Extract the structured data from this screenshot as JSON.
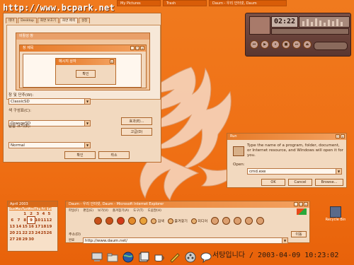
{
  "watermark": "http://www.bcpark.net",
  "taskbar_top": [
    {
      "label": "My Pictures"
    },
    {
      "label": "Trash"
    },
    {
      "label": "Daum - 우리 인터넷, Daum"
    }
  ],
  "display_props": {
    "tabs": [
      "테마",
      "Desktop",
      "화면 보호기",
      "화면 배색",
      "설정"
    ],
    "active_tab": 3,
    "preview_msg_title": "메시지 상자",
    "preview_normal_label": "창 제목",
    "preview_ok": "확인",
    "preview_inactive": "비활성 창",
    "window_buttons_label": "창 및 단추(W):",
    "window_buttons_value": "ClassicSD",
    "color_scheme_label": "색 구성표(C):",
    "color_scheme_value": "OrangeSD",
    "font_size_label": "글꼴 크기(E):",
    "font_size_value": "Normal",
    "effects_button": "효과(E)...",
    "advanced_button": "고급(D)",
    "ok_button": "확인",
    "cancel_button": "취소"
  },
  "media_player": {
    "time": "02:22",
    "controls": [
      "prev",
      "play",
      "pause",
      "stop",
      "next",
      "eject"
    ]
  },
  "run_dialog": {
    "title": "Run",
    "message": "Type the name of a program, folder, document, or Internet resource, and Windows will open it for you.",
    "open_label": "Open:",
    "open_value": "cmd.exe",
    "ok": "OK",
    "cancel": "Cancel",
    "browse": "Browse..."
  },
  "calendar": {
    "month": "April 2003",
    "weekdays": [
      "Sun",
      "Mon",
      "Tue",
      "Wed",
      "Thu",
      "Fri",
      "Sat"
    ],
    "weeks": [
      [
        "",
        "",
        "1",
        "2",
        "3",
        "4",
        "5"
      ],
      [
        "6",
        "7",
        "8",
        "9",
        "10",
        "11",
        "12"
      ],
      [
        "13",
        "14",
        "15",
        "16",
        "17",
        "18",
        "19"
      ],
      [
        "20",
        "21",
        "22",
        "23",
        "24",
        "25",
        "26"
      ],
      [
        "27",
        "28",
        "29",
        "30",
        "",
        "",
        ""
      ]
    ],
    "today": "9"
  },
  "browser": {
    "title": "Daum - 우리 인터넷, Daum - Microsoft Internet Explorer",
    "menu": [
      "파일(F)",
      "편집(E)",
      "보기(V)",
      "즐겨찾기(A)",
      "도구(T)",
      "도움말(H)"
    ],
    "address_label": "주소(D)",
    "address": "http://www.daum.net/",
    "go_label": "이동",
    "status": "완료",
    "toolbar": [
      {
        "name": "back",
        "color": "#c8501a"
      },
      {
        "name": "forward",
        "color": "#c8501a"
      },
      {
        "name": "stop",
        "color": "#d23a1a"
      },
      {
        "name": "refresh",
        "color": "#e28a2a"
      },
      {
        "name": "home",
        "color": "#e8a23a"
      }
    ],
    "toolbar_labels": {
      "search": "검색",
      "favorites": "즐겨찾기",
      "media": "미디어"
    }
  },
  "recycle_bin": {
    "label": "Recycle Bin"
  },
  "clock": {
    "text": "서탕입니다 / 2003-04-09 10:23:02"
  },
  "colors": {
    "desktop": "#f07a1e",
    "window": "#f2d9bf",
    "titlebar": "#e67a28",
    "accent": "#a33a0a"
  }
}
